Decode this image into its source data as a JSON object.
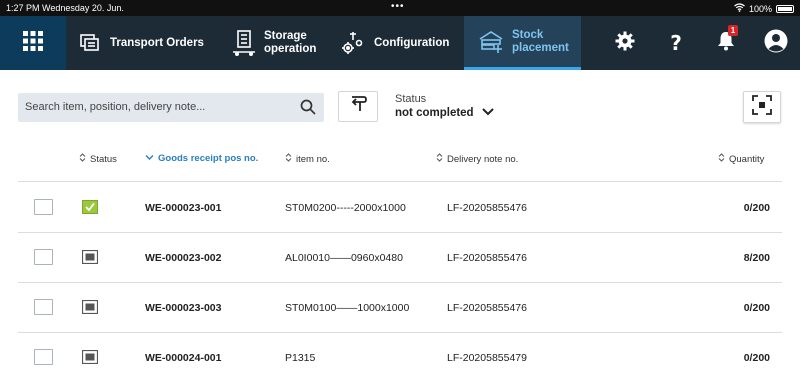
{
  "status_bar": {
    "time_date": "1:27 PM  Wednesday 20. Jun.",
    "center": "•••",
    "battery": "100%"
  },
  "nav": {
    "items": [
      {
        "label": "Transport Orders",
        "icon": "transport-orders-icon"
      },
      {
        "label": "Storage operation",
        "icon": "storage-operation-icon"
      },
      {
        "label": "Configuration",
        "icon": "configuration-icon"
      },
      {
        "label": "Stock placement",
        "icon": "stock-placement-icon",
        "active": true
      }
    ],
    "notification_count": "1",
    "colors": {
      "bar": "#1d2b37",
      "active": "#24435b",
      "accent": "#3aa8e8",
      "badge": "#d7262a"
    }
  },
  "toolbar": {
    "search_placeholder": "Search item, position, delivery note...",
    "status_label": "Status",
    "status_value": "not completed"
  },
  "table": {
    "headers": {
      "status": "Status",
      "goods_receipt": "Goods receipt pos no.",
      "item_no": "item no.",
      "delivery_note": "Delivery note no.",
      "quantity": "Quantity"
    },
    "rows": [
      {
        "status": "done",
        "goods_receipt": "WE-000023-001",
        "item_no": "ST0M0200-----2000x1000",
        "delivery_note": "LF-20205855476",
        "quantity": "0/200"
      },
      {
        "status": "open",
        "goods_receipt": "WE-000023-002",
        "item_no": "AL0I0010——0960x0480",
        "delivery_note": "LF-20205855476",
        "quantity": "8/200"
      },
      {
        "status": "open",
        "goods_receipt": "WE-000023-003",
        "item_no": "ST0M0100——1000x1000",
        "delivery_note": "LF-20205855476",
        "quantity": "0/200"
      },
      {
        "status": "open",
        "goods_receipt": "WE-000024-001",
        "item_no": "P1315",
        "delivery_note": "LF-20205855479",
        "quantity": "0/200"
      }
    ]
  }
}
